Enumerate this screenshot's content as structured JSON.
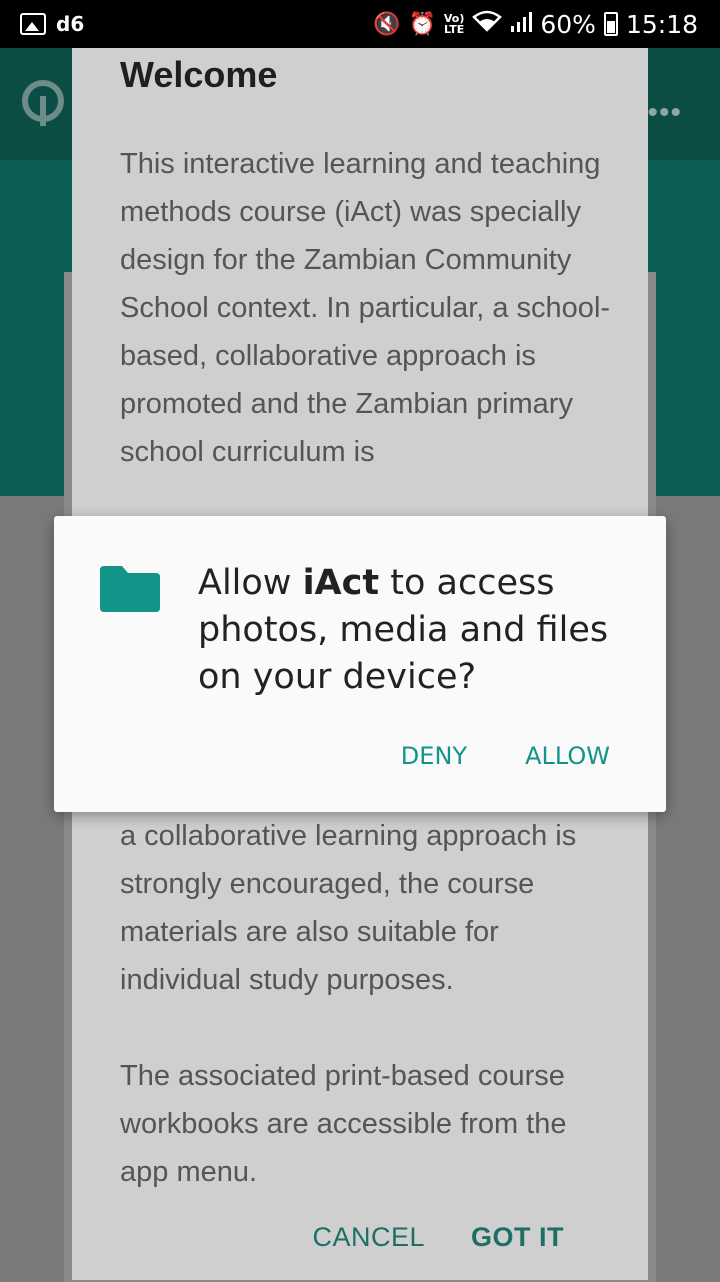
{
  "status_bar": {
    "carrier": "d6",
    "network": {
      "volte": "Vo)",
      "lte": "LTE"
    },
    "battery": "60%",
    "time": "15:18"
  },
  "app_bar": {
    "more_label": "•••"
  },
  "welcome_dialog": {
    "title": "Welcome",
    "body_visible_top": "This interactive learning and teaching methods course (iAct) was specially design for the Zambian Community School context. In particular, a school-based, collaborative approach is promoted and the Zambian primary school curriculum is",
    "body_visible_bottom": "a collaborative learning approach is strongly encouraged, the course materials are also suitable for individual study purposes.",
    "body_paragraph_2": "The associated print-based course workbooks are accessible from the app menu.",
    "cancel_label": "CANCEL",
    "confirm_label": "GOT IT"
  },
  "permission_dialog": {
    "prefix": "Allow ",
    "app_name": "iAct",
    "suffix": " to access photos, media and files on your device?",
    "deny_label": "DENY",
    "allow_label": "ALLOW"
  },
  "colors": {
    "accent": "#139488",
    "app_bar": "#0b4d44",
    "folder_icon": "#139488"
  }
}
